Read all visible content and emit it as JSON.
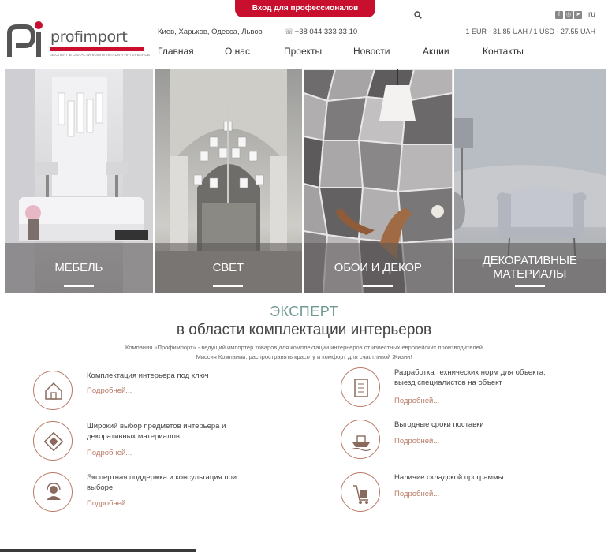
{
  "header": {
    "pro_button": "Вход для профессионалов",
    "logo_word": "profimport",
    "logo_tagline": "ЭКСПЕРТ В ОБЛАСТИ КОМПЛЕКТАЦИИ ИНТЕРЬЕРОВ",
    "cities": "Киев, Харьков, Одесса, Львов",
    "phone": "+38 044 333 33 10",
    "search_placeholder": "",
    "language": "ru",
    "rates": "1 EUR - 31.85 UAH / 1 USD - 27.55 UAH",
    "socials": [
      "f",
      "◎",
      "➤"
    ]
  },
  "nav": [
    "Главная",
    "О нас",
    "Проекты",
    "Новости",
    "Акции",
    "Контакты"
  ],
  "tiles": [
    {
      "title": "МЕБЕЛЬ"
    },
    {
      "title": "СВЕТ"
    },
    {
      "title": "ОБОИ И ДЕКОР"
    },
    {
      "title": "ДЕКОРАТИВНЫЕ МАТЕРИАЛЫ"
    }
  ],
  "about": {
    "heading": "ЭКСПЕРТ",
    "subheading": "в области комплектации интерьеров",
    "line1": "Компания «Профимпорт» - ведущий импортер товаров для комплектации интерьеров от известных европейских производителей",
    "line2": "Миссия Компании: распространять красоту и комфорт для счастливой Жизни!"
  },
  "features": [
    {
      "icon": "house-icon",
      "text": "Комплектация интерьера под ключ",
      "more": "Подробней..."
    },
    {
      "icon": "document-icon",
      "text": "Разработка технических норм для объекта; выезд специалистов на объект",
      "more": "Подробней..."
    },
    {
      "icon": "pattern-icon",
      "text": "Широкий выбор предметов интерьера и декоративных материалов",
      "more": "Подробней..."
    },
    {
      "icon": "ship-icon",
      "text": "Выгодные сроки поставки",
      "more": "Подробней..."
    },
    {
      "icon": "support-icon",
      "text": "Экспертная поддержка и консультация при выборе",
      "more": "Подробней..."
    },
    {
      "icon": "warehouse-cart-icon",
      "text": "Наличие складской программы",
      "more": "Подробней..."
    }
  ],
  "colors": {
    "brand_red": "#c8102e",
    "accent_teal": "#6f9a92",
    "accent_copper": "#b87a66"
  }
}
